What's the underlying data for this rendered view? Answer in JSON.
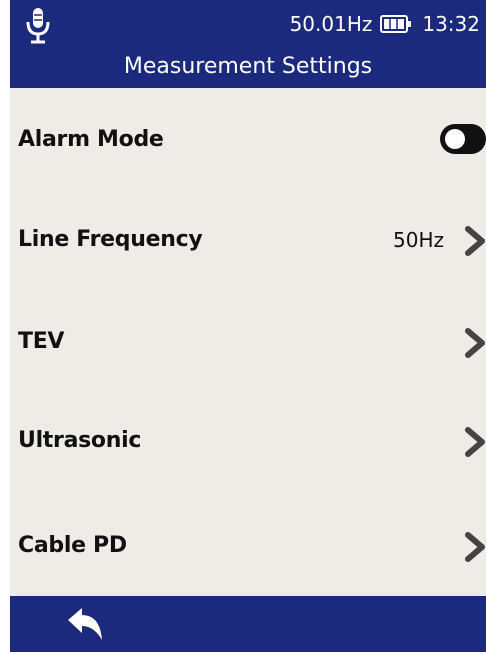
{
  "header": {
    "frequency": "50.01Hz",
    "time": "13:32",
    "title": "Measurement Settings"
  },
  "settings": [
    {
      "label": "Alarm Mode",
      "control": "toggle",
      "toggle_on": false
    },
    {
      "label": "Line Frequency",
      "value": "50Hz",
      "control": "chevron"
    },
    {
      "label": "TEV",
      "control": "chevron"
    },
    {
      "label": "Ultrasonic",
      "control": "chevron"
    },
    {
      "label": "Cable PD",
      "control": "chevron"
    }
  ],
  "footer": {
    "back_icon": "back-arrow-icon"
  },
  "icons": {
    "status": [
      "microphone-icon",
      "battery-icon"
    ],
    "row": "chevron-right-icon"
  },
  "colors": {
    "bar": "#1c2a7d",
    "background": "#efece8",
    "text": "#111111",
    "chevron": "#444444"
  }
}
